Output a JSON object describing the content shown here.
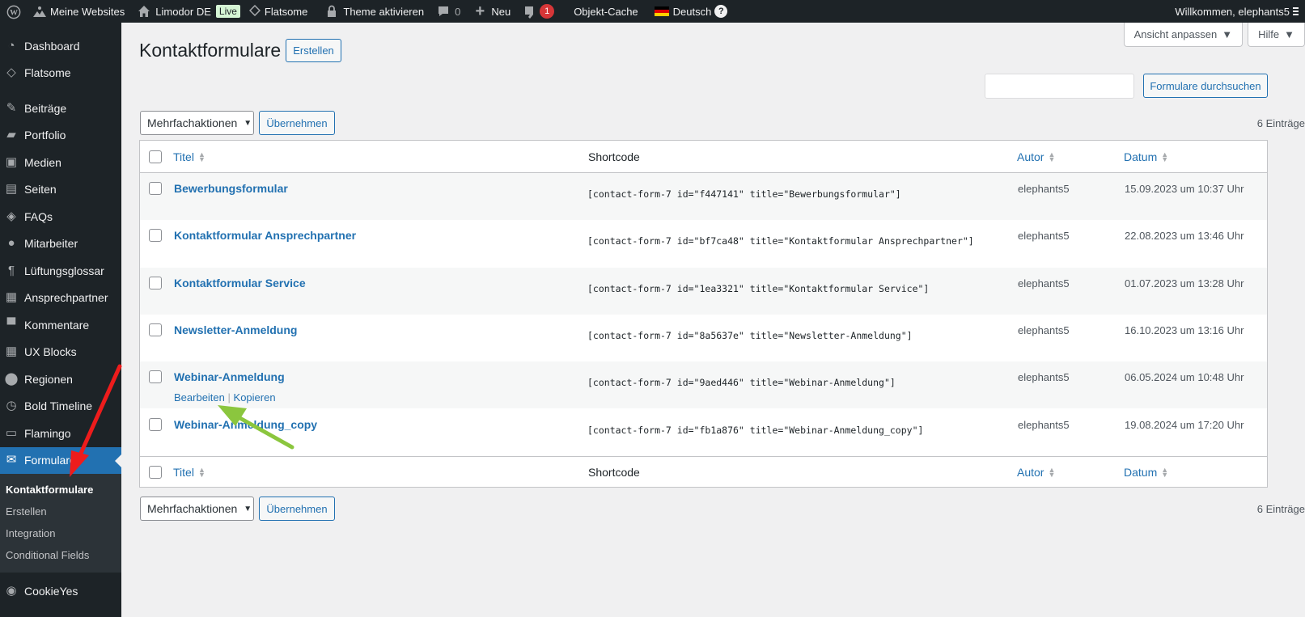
{
  "adminbar": {
    "my_sites": "Meine Websites",
    "site_name": "Limodor DE",
    "live_badge": "Live",
    "theme": "Flatsome",
    "activate_theme": "Theme aktivieren",
    "comments_count": "0",
    "new": "Neu",
    "yoast_count": "1",
    "object_cache": "Objekt-Cache",
    "language": "Deutsch",
    "help_icon": "?",
    "greeting": "Willkommen, elephants5"
  },
  "sidebar": {
    "items": [
      {
        "label": "Dashboard",
        "icon": "dashboard-icon"
      },
      {
        "label": "Flatsome",
        "icon": "flatsome-icon"
      },
      {
        "label": "Beiträge",
        "icon": "pin-icon"
      },
      {
        "label": "Portfolio",
        "icon": "folder-icon"
      },
      {
        "label": "Medien",
        "icon": "media-icon"
      },
      {
        "label": "Seiten",
        "icon": "pages-icon"
      },
      {
        "label": "FAQs",
        "icon": "tag-icon"
      },
      {
        "label": "Mitarbeiter",
        "icon": "user-icon"
      },
      {
        "label": "Lüftungsglossar",
        "icon": "paragraph-icon"
      },
      {
        "label": "Ansprechpartner",
        "icon": "cards-icon"
      },
      {
        "label": "Kommentare",
        "icon": "comment-icon"
      },
      {
        "label": "UX Blocks",
        "icon": "grid-icon"
      },
      {
        "label": "Regionen",
        "icon": "location-icon"
      },
      {
        "label": "Bold Timeline",
        "icon": "clock-icon"
      },
      {
        "label": "Flamingo",
        "icon": "inbox-icon"
      },
      {
        "label": "Formulare",
        "icon": "mail-icon"
      }
    ],
    "submenu": [
      "Kontaktformulare",
      "Erstellen",
      "Integration",
      "Conditional Fields"
    ],
    "last_item": {
      "label": "CookieYes",
      "icon": "cookie-icon"
    }
  },
  "screen_options": "Ansicht anpassen",
  "help": "Hilfe",
  "page_title": "Kontaktformulare",
  "add_new": "Erstellen",
  "search_button": "Formulare durchsuchen",
  "search_value": "",
  "bulk": {
    "selected": "Mehrfachaktionen",
    "apply": "Übernehmen"
  },
  "count": "6 Einträge",
  "columns": {
    "title": "Titel",
    "shortcode": "Shortcode",
    "author": "Autor",
    "date": "Datum"
  },
  "rows": [
    {
      "title": "Bewerbungsformular",
      "shortcode": "[contact-form-7 id=\"f447141\" title=\"Bewerbungsformular\"]",
      "author": "elephants5",
      "date": "15.09.2023 um 10:37 Uhr"
    },
    {
      "title": "Kontaktformular Ansprechpartner",
      "shortcode": "[contact-form-7 id=\"bf7ca48\" title=\"Kontaktformular Ansprechpartner\"]",
      "author": "elephants5",
      "date": "22.08.2023 um 13:46 Uhr"
    },
    {
      "title": "Kontaktformular Service",
      "shortcode": "[contact-form-7 id=\"1ea3321\" title=\"Kontaktformular Service\"]",
      "author": "elephants5",
      "date": "01.07.2023 um 13:28 Uhr"
    },
    {
      "title": "Newsletter-Anmeldung",
      "shortcode": "[contact-form-7 id=\"8a5637e\" title=\"Newsletter-Anmeldung\"]",
      "author": "elephants5",
      "date": "16.10.2023 um 13:16 Uhr"
    },
    {
      "title": "Webinar-Anmeldung",
      "shortcode": "[contact-form-7 id=\"9aed446\" title=\"Webinar-Anmeldung\"]",
      "author": "elephants5",
      "date": "06.05.2024 um 10:48 Uhr"
    },
    {
      "title": "Webinar-Anmeldung_copy",
      "shortcode": "[contact-form-7 id=\"fb1a876\" title=\"Webinar-Anmeldung_copy\"]",
      "author": "elephants5",
      "date": "19.08.2024 um 17:20 Uhr"
    }
  ],
  "row_actions": {
    "edit": "Bearbeiten",
    "separator": "|",
    "copy": "Kopieren"
  },
  "annotation_colors": {
    "red_arrow": "#ee1c1c",
    "green_arrow": "#8bc63e"
  }
}
